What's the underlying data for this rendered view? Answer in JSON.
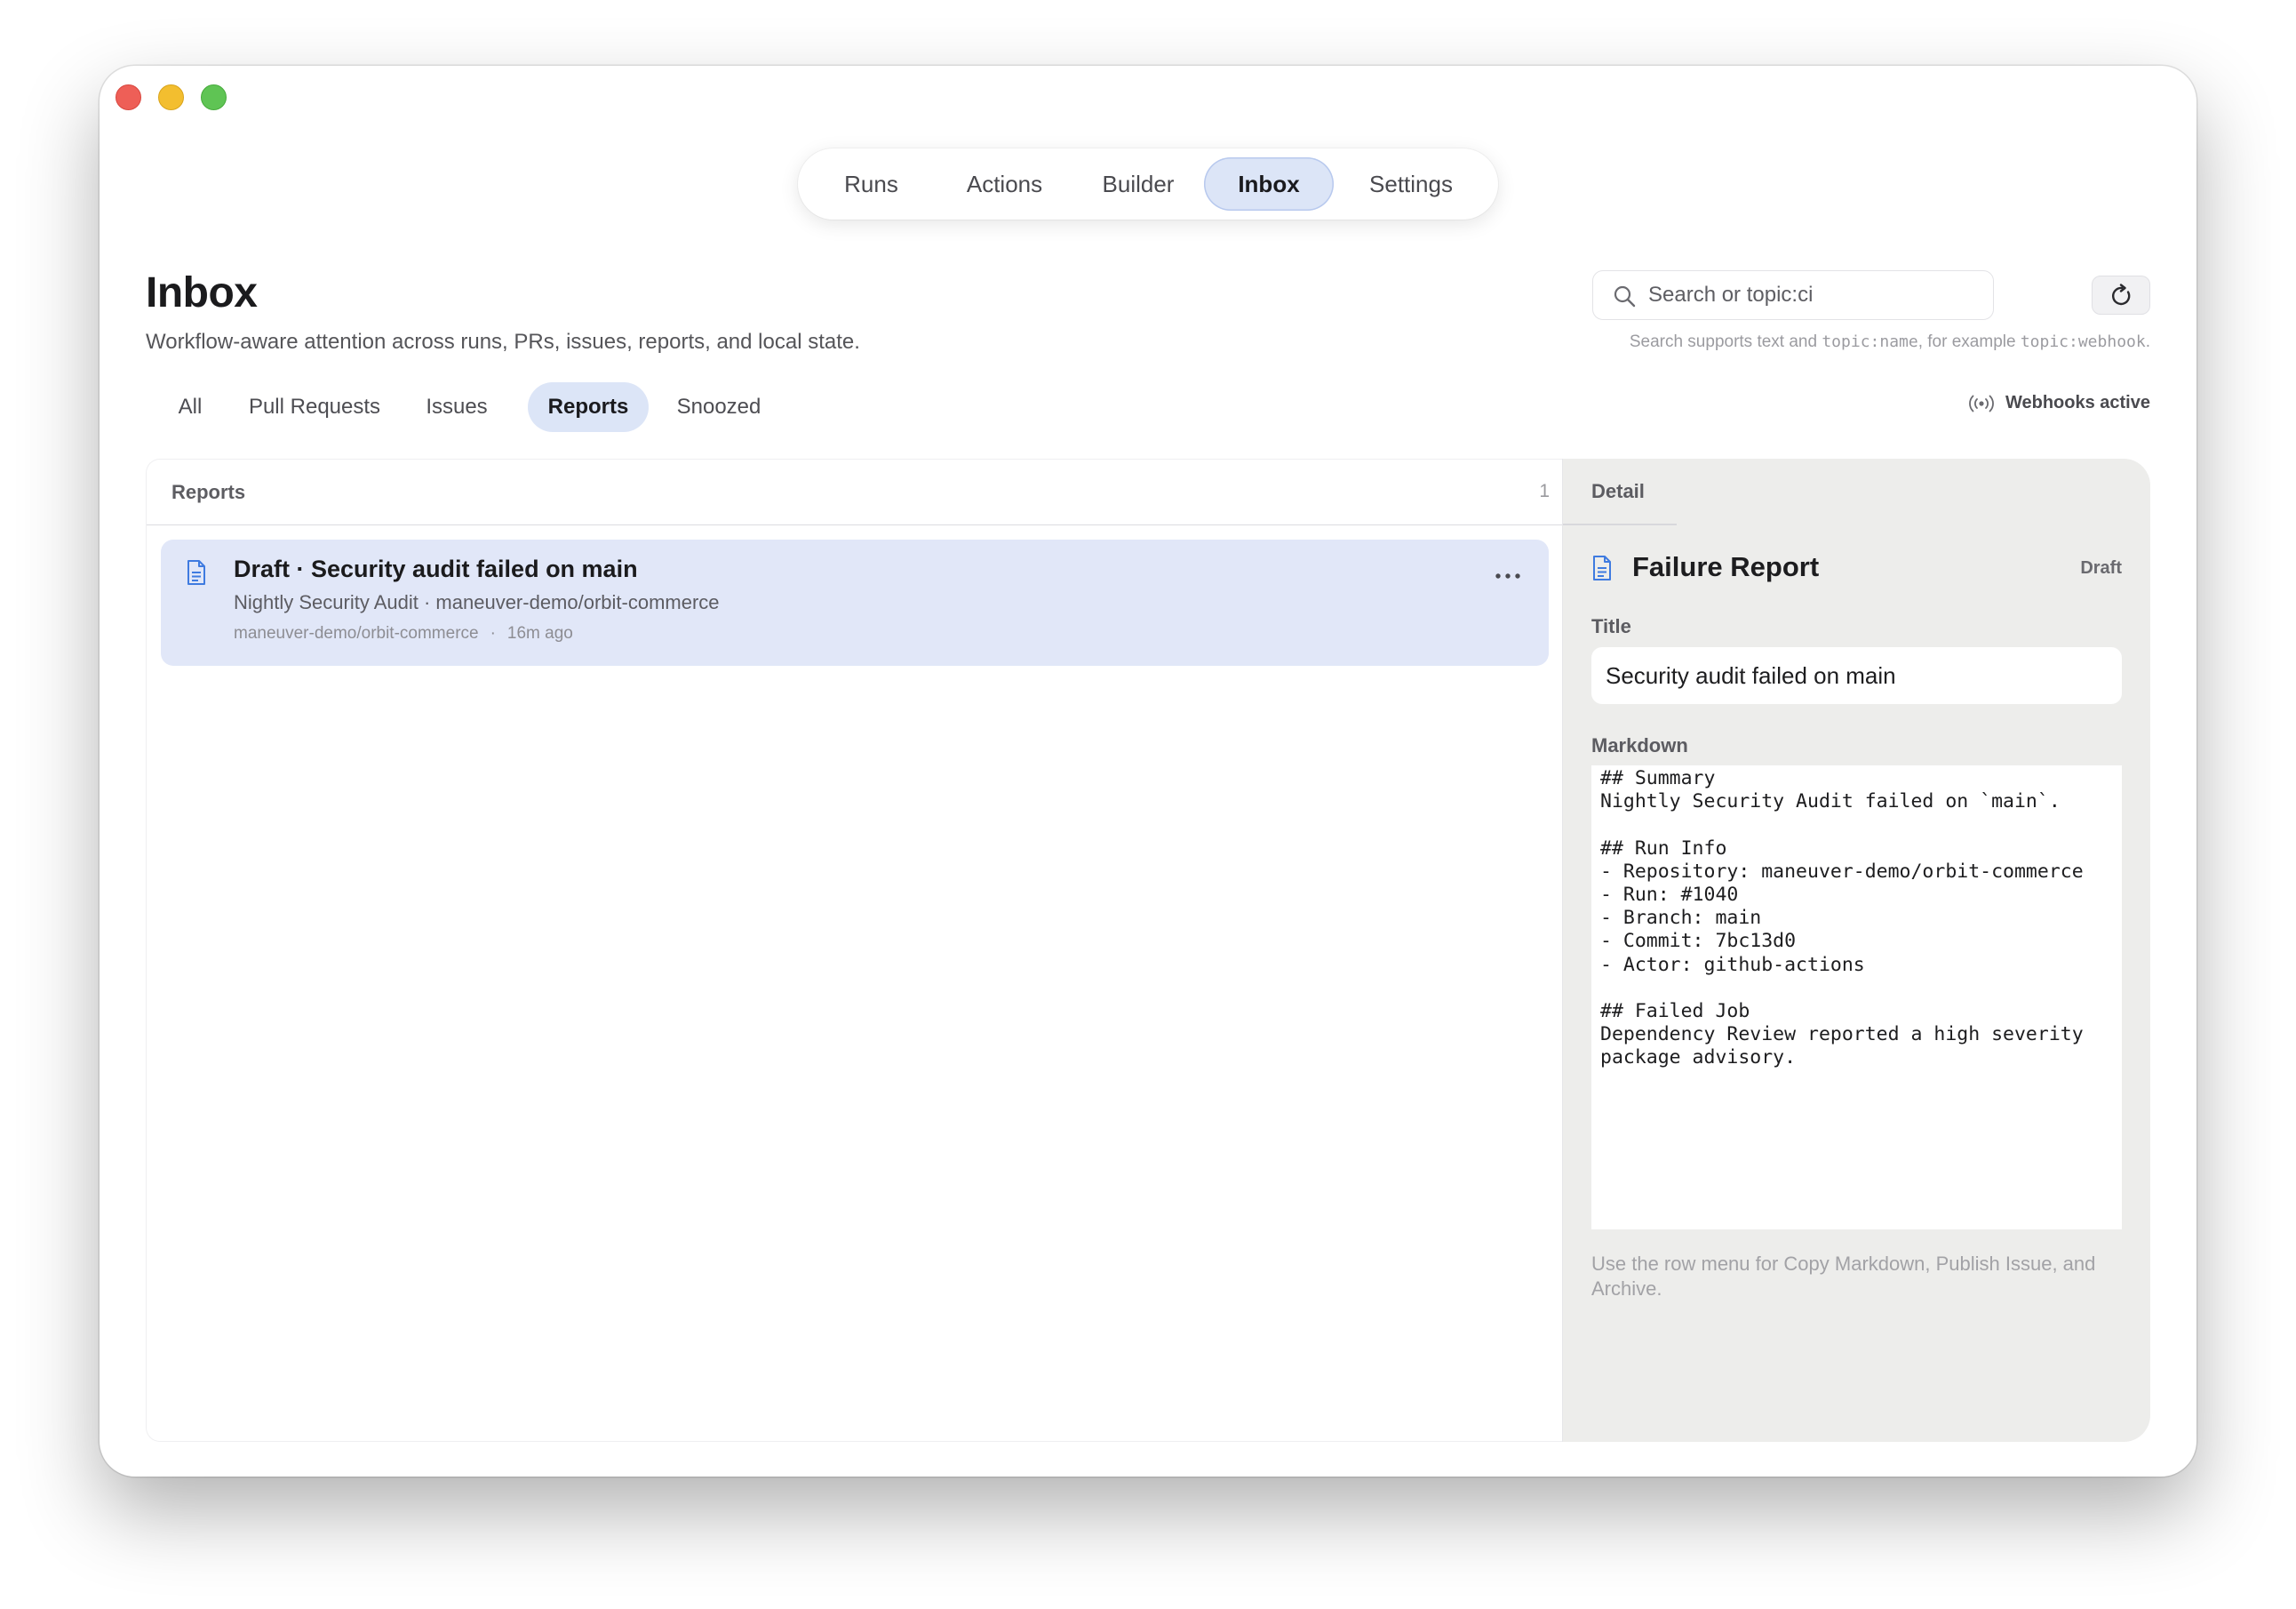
{
  "nav": {
    "tabs": [
      {
        "label": "Runs"
      },
      {
        "label": "Actions"
      },
      {
        "label": "Builder"
      },
      {
        "label": "Inbox"
      },
      {
        "label": "Settings"
      }
    ],
    "active": "Inbox"
  },
  "header": {
    "title": "Inbox",
    "subtitle": "Workflow-aware attention across runs, PRs, issues, reports, and local state."
  },
  "search": {
    "placeholder": "Search or topic:ci",
    "value": "",
    "hint_prefix": "Search supports text and ",
    "hint_code1": "topic:name",
    "hint_middle": ", for example ",
    "hint_code2": "topic:webhook",
    "hint_suffix": "."
  },
  "filters": {
    "items": [
      {
        "label": "All"
      },
      {
        "label": "Pull Requests"
      },
      {
        "label": "Issues"
      },
      {
        "label": "Reports"
      },
      {
        "label": "Snoozed"
      }
    ],
    "active": "Reports"
  },
  "webhooks": {
    "label": "Webhooks active"
  },
  "list": {
    "header": "Reports",
    "count": "1",
    "rows": [
      {
        "title": "Draft · Security audit failed on main",
        "subtitle": "Nightly Security Audit · maneuver-demo/orbit-commerce",
        "repo": "maneuver-demo/orbit-commerce",
        "separator": "·",
        "time": "16m ago"
      }
    ]
  },
  "detail": {
    "header": "Detail",
    "title": "Failure Report",
    "status": "Draft",
    "title_label": "Title",
    "title_value": "Security audit failed on main",
    "markdown_label": "Markdown",
    "markdown": "## Summary\nNightly Security Audit failed on `main`.\n\n## Run Info\n- Repository: maneuver-demo/orbit-commerce\n- Run: #1040\n- Branch: main\n- Commit: 7bc13d0\n- Actor: github-actions\n\n## Failed Job\nDependency Review reported a high severity\npackage advisory.",
    "hint": "Use the row menu for Copy Markdown, Publish Issue, and Archive."
  },
  "colors": {
    "accent_bg": "#dce5f7",
    "row_selected_bg": "#e1e7f8",
    "detail_bg": "#ededeb",
    "icon_blue": "#3f7be0"
  }
}
